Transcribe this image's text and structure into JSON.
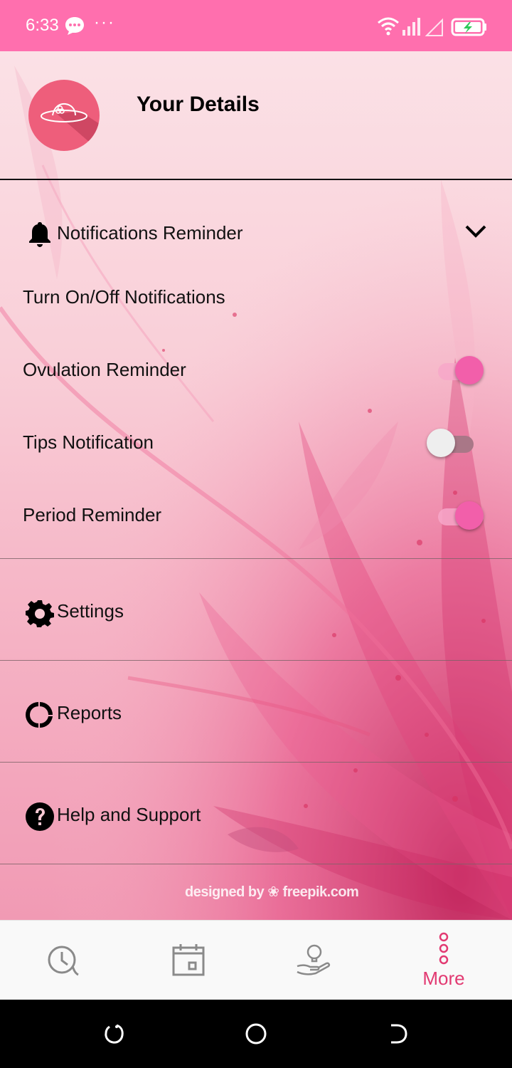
{
  "status_bar": {
    "time": "6:33",
    "dots": "···",
    "color": "#ff6fae"
  },
  "header": {
    "title": "Your Details"
  },
  "notifications": {
    "section_title": "Notifications Reminder",
    "expanded": true,
    "items": [
      {
        "label": "Turn On/Off Notifications"
      },
      {
        "label": "Ovulation Reminder",
        "enabled": true
      },
      {
        "label": "Tips Notification",
        "enabled": false
      },
      {
        "label": "Period Reminder",
        "enabled": true
      }
    ]
  },
  "menu": {
    "settings": "Settings",
    "reports": "Reports",
    "help": "Help and Support"
  },
  "watermark": "designed by ❀ freepik.com",
  "bottom_nav": {
    "items": [
      {
        "icon": "history-clock-icon"
      },
      {
        "icon": "calendar-icon"
      },
      {
        "icon": "tips-lightbulb-icon"
      },
      {
        "icon": "more-vertical-icon",
        "label": "More",
        "active": true
      }
    ],
    "active_color": "#e23a72"
  },
  "colors": {
    "toggle_on": "#f25faa",
    "toggle_off": "#eeeeee",
    "avatar": "#ee5e7b"
  }
}
